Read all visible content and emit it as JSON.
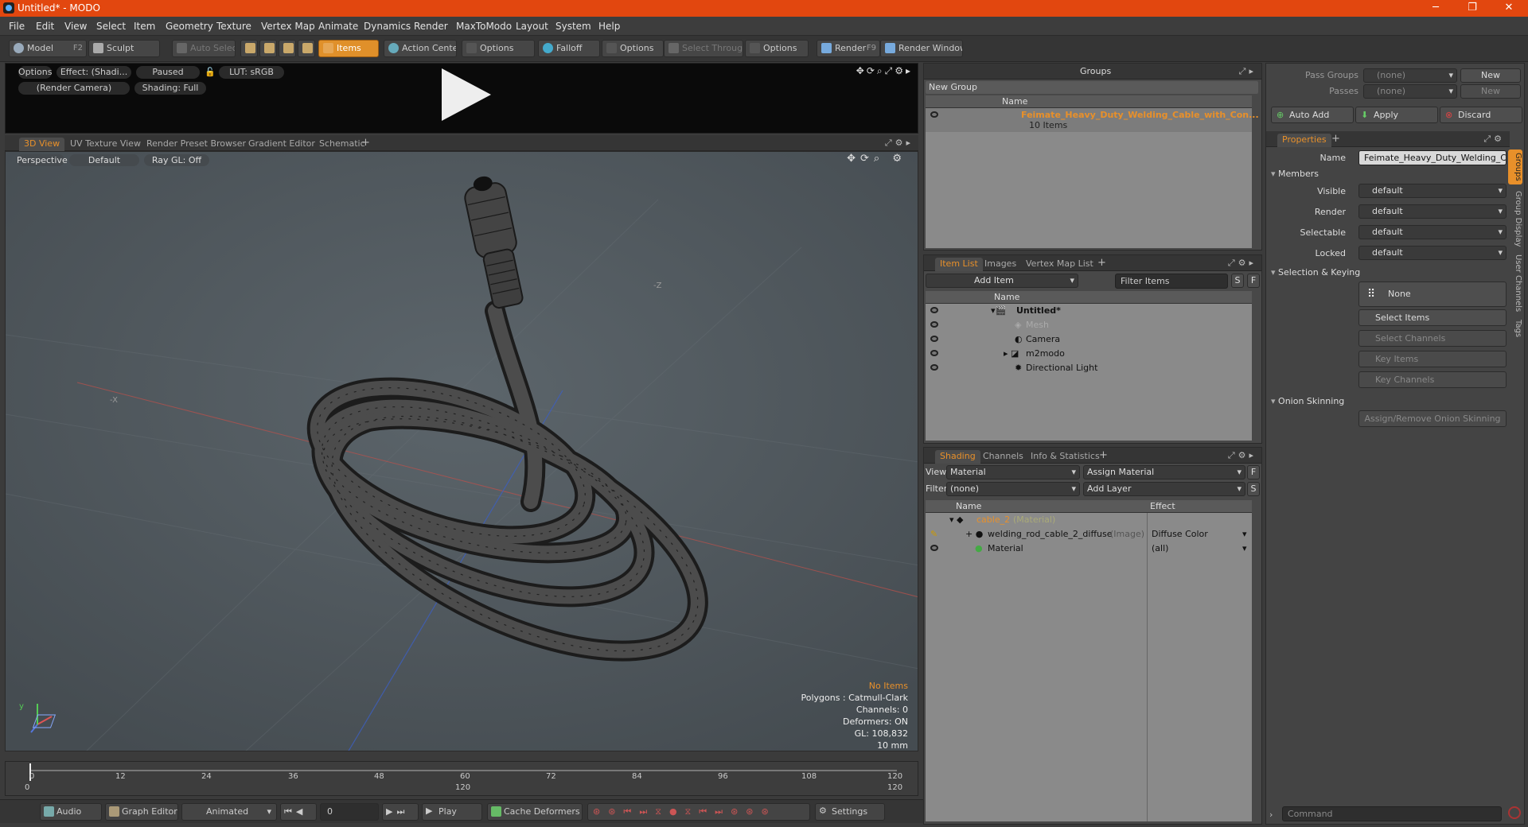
{
  "app": {
    "title": "Untitled* - MODO",
    "controls": {
      "minimize": "─",
      "restore": "❐",
      "close": "✕"
    }
  },
  "menu": [
    "File",
    "Edit",
    "View",
    "Select",
    "Item",
    "Geometry",
    "Texture",
    "Vertex Map",
    "Animate",
    "Dynamics",
    "Render",
    "MaxToModo",
    "Layout",
    "System",
    "Help"
  ],
  "toolbar": {
    "model": "Model",
    "model_key": "F2",
    "sculpt": "Sculpt",
    "auto_select": "Auto Select",
    "items": "Items",
    "action_center": "Action Center",
    "options1": "Options",
    "falloff": "Falloff",
    "options2": "Options",
    "select_through": "Select Through",
    "options3": "Options",
    "render": "Render",
    "render_key": "F9",
    "render_window": "Render Window"
  },
  "preview": {
    "options": "Options",
    "effect": "Effect: (Shadi...",
    "paused": "Paused",
    "lut": "LUT: sRGB",
    "camera": "(Render Camera)",
    "shading": "Shading: Full"
  },
  "viewport_tabs": [
    "3D View",
    "UV Texture View",
    "Render Preset Browser",
    "Gradient Editor",
    "Schematic"
  ],
  "viewport": {
    "perspective": "Perspective",
    "default": "Default",
    "raygl": "Ray GL: Off",
    "axis_neg_x": "-X",
    "axis_neg_z": "-Z",
    "hud": {
      "items": "No Items",
      "polygons": "Polygons : Catmull-Clark",
      "channels": "Channels: 0",
      "deformers": "Deformers: ON",
      "gl": "GL: 108,832",
      "unit": "10 mm"
    }
  },
  "timeline": {
    "ticks": [
      "0",
      "12",
      "24",
      "36",
      "48",
      "60",
      "72",
      "84",
      "96",
      "108",
      "120"
    ],
    "bottom_ticks": {
      "start": "0",
      "mid": "120",
      "end": "120"
    }
  },
  "bottom": {
    "audio": "Audio",
    "graph_editor": "Graph Editor",
    "animated": "Animated",
    "frame": "0",
    "play": "Play",
    "cache_deformers": "Cache Deformers",
    "settings": "Settings"
  },
  "groups": {
    "title": "Groups",
    "new_group": "New Group",
    "col_name": "Name",
    "item_name": "Feimate_Heavy_Duty_Welding_Cable_with_Con...",
    "item_count": "10 Items"
  },
  "item_list": {
    "tabs": [
      "Item List",
      "Images",
      "Vertex Map List"
    ],
    "add_item": "Add Item",
    "filter": "Filter Items",
    "s": "S",
    "f": "F",
    "col_name": "Name",
    "rows": [
      "Untitled*",
      "Mesh",
      "Camera",
      "m2modo",
      "Directional Light"
    ]
  },
  "shading": {
    "tabs": [
      "Shading",
      "Channels",
      "Info & Statistics"
    ],
    "view_label": "View",
    "view_value": "Material",
    "assign": "Assign Material",
    "f": "F",
    "filter_label": "Filter",
    "filter_value": "(none)",
    "add_layer": "Add Layer",
    "s": "S",
    "col_name": "Name",
    "col_effect": "Effect",
    "rows": [
      {
        "name": "cable_2",
        "type": "(Material)",
        "effect": ""
      },
      {
        "name": "welding_rod_cable_2_diffuse",
        "type": "(Image)",
        "effect": "Diffuse Color"
      },
      {
        "name": "Material",
        "type": "",
        "effect": "(all)"
      }
    ]
  },
  "right": {
    "pass_groups": "Pass Groups",
    "passes": "Passes",
    "none": "(none)",
    "new": "New",
    "auto_add": "Auto Add",
    "apply": "Apply",
    "discard": "Discard",
    "properties_tab": "Properties",
    "name_label": "Name",
    "name_value": "Feimate_Heavy_Duty_Welding_Cab",
    "members": "Members",
    "visible": "Visible",
    "render": "Render",
    "selectable": "Selectable",
    "locked": "Locked",
    "default": "default",
    "sel_keying": "Selection & Keying",
    "none_btn": "None",
    "select_items": "Select Items",
    "select_channels": "Select Channels",
    "key_items": "Key Items",
    "key_channels": "Key Channels",
    "onion": "Onion Skinning",
    "assign_onion": "Assign/Remove Onion Skinning",
    "side_tabs": [
      "Groups",
      "Group Display",
      "User Channels",
      "Tags"
    ],
    "command": "Command"
  },
  "colors": {
    "accent": "#e8902a",
    "titlebar": "#e2470f"
  }
}
